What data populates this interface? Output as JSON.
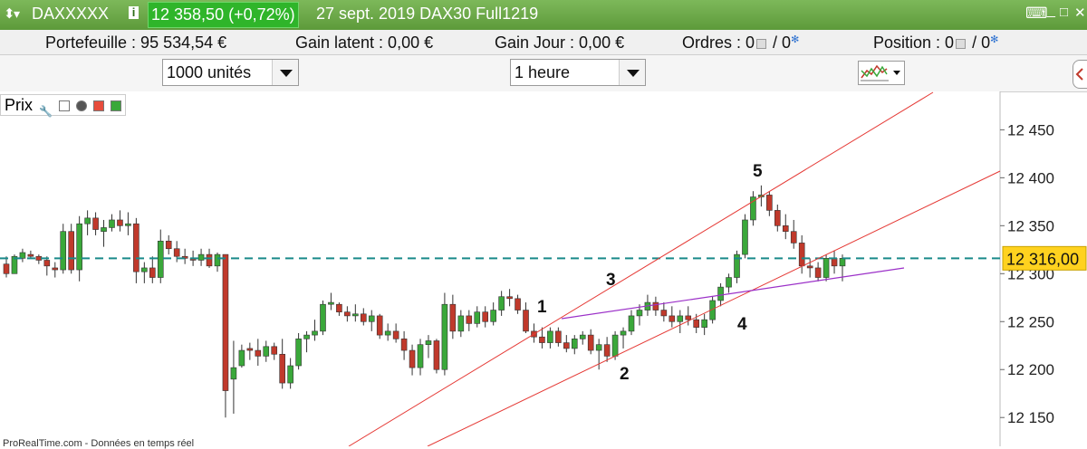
{
  "titlebar": {
    "symbol": "DAXXXXX",
    "quote": "12 358,50 (+0,72%)",
    "description": "27 sept. 2019 DAX30 Full1219"
  },
  "infobar": {
    "portefeuille": "Portefeuille : 95 534,54 €",
    "gain_latent": "Gain latent : 0,00 €",
    "gain_jour": "Gain Jour : 0,00 €",
    "ordres_label": "Ordres : 0",
    "ordres_sep": "/ 0",
    "position_label": "Position : 0",
    "position_sep": "/ 0"
  },
  "toolbar": {
    "quantity": "1000 unités",
    "timeframe": "1 heure"
  },
  "panel": {
    "title": "Prix"
  },
  "footer": "ProRealTime.com - Données en temps réel",
  "colors": {
    "up": "#3aa83a",
    "down": "#c0392b",
    "channel": "#e53935",
    "trend": "#9b30c8",
    "level": "#1a8a8a",
    "price_tag": "#ffd21f"
  },
  "chart_data": {
    "type": "candlestick",
    "ylim": [
      12120,
      12490
    ],
    "y_ticks": [
      "12 450",
      "12 400",
      "12 350",
      "12 300",
      "12 250",
      "12 200",
      "12 150"
    ],
    "current_price_label": "12 316,00",
    "current_price": 12316,
    "wave_labels": [
      "1",
      "2",
      "3",
      "4",
      "5"
    ],
    "candles": [
      [
        12310,
        12318,
        12296,
        12300
      ],
      [
        12300,
        12320,
        12312,
        12318
      ],
      [
        12316,
        12326,
        12312,
        12322
      ],
      [
        12320,
        12324,
        12316,
        12318
      ],
      [
        12318,
        12320,
        12310,
        12314
      ],
      [
        12314,
        12318,
        12298,
        12308
      ],
      [
        12306,
        12312,
        12296,
        12304
      ],
      [
        12304,
        12352,
        12300,
        12344
      ],
      [
        12344,
        12352,
        12300,
        12304
      ],
      [
        12304,
        12360,
        12292,
        12352
      ],
      [
        12352,
        12366,
        12340,
        12358
      ],
      [
        12358,
        12364,
        12340,
        12346
      ],
      [
        12344,
        12356,
        12328,
        12348
      ],
      [
        12348,
        12362,
        12344,
        12356
      ],
      [
        12356,
        12366,
        12344,
        12350
      ],
      [
        12350,
        12364,
        12340,
        12352
      ],
      [
        12352,
        12358,
        12290,
        12302
      ],
      [
        12302,
        12312,
        12290,
        12306
      ],
      [
        12306,
        12318,
        12290,
        12296
      ],
      [
        12296,
        12346,
        12290,
        12334
      ],
      [
        12334,
        12340,
        12320,
        12326
      ],
      [
        12326,
        12334,
        12312,
        12318
      ],
      [
        12318,
        12326,
        12310,
        12316
      ],
      [
        12316,
        12324,
        12308,
        12314
      ],
      [
        12314,
        12326,
        12308,
        12320
      ],
      [
        12320,
        12326,
        12306,
        12308
      ],
      [
        12308,
        12322,
        12302,
        12320
      ],
      [
        12320,
        12314,
        12150,
        12178
      ],
      [
        12190,
        12230,
        12154,
        12202
      ],
      [
        12204,
        12226,
        12202,
        12220
      ],
      [
        12222,
        12228,
        12210,
        12220
      ],
      [
        12220,
        12232,
        12204,
        12214
      ],
      [
        12214,
        12230,
        12208,
        12224
      ],
      [
        12224,
        12228,
        12210,
        12216
      ],
      [
        12216,
        12232,
        12180,
        12186
      ],
      [
        12186,
        12212,
        12180,
        12204
      ],
      [
        12204,
        12238,
        12200,
        12232
      ],
      [
        12232,
        12240,
        12218,
        12236
      ],
      [
        12236,
        12252,
        12230,
        12240
      ],
      [
        12240,
        12272,
        12236,
        12268
      ],
      [
        12268,
        12280,
        12262,
        12270
      ],
      [
        12268,
        12270,
        12256,
        12260
      ],
      [
        12260,
        12266,
        12250,
        12256
      ],
      [
        12256,
        12268,
        12250,
        12258
      ],
      [
        12258,
        12264,
        12246,
        12250
      ],
      [
        12250,
        12262,
        12240,
        12256
      ],
      [
        12256,
        12258,
        12232,
        12236
      ],
      [
        12236,
        12248,
        12230,
        12240
      ],
      [
        12240,
        12248,
        12228,
        12232
      ],
      [
        12232,
        12240,
        12210,
        12220
      ],
      [
        12220,
        12226,
        12194,
        12202
      ],
      [
        12202,
        12232,
        12194,
        12226
      ],
      [
        12226,
        12236,
        12212,
        12230
      ],
      [
        12230,
        12232,
        12196,
        12200
      ],
      [
        12200,
        12280,
        12194,
        12268
      ],
      [
        12268,
        12278,
        12232,
        12240
      ],
      [
        12240,
        12262,
        12234,
        12256
      ],
      [
        12256,
        12262,
        12240,
        12248
      ],
      [
        12248,
        12266,
        12244,
        12260
      ],
      [
        12260,
        12266,
        12244,
        12250
      ],
      [
        12250,
        12270,
        12246,
        12262
      ],
      [
        12262,
        12282,
        12256,
        12276
      ],
      [
        12276,
        12284,
        12266,
        12274
      ],
      [
        12274,
        12278,
        12258,
        12262
      ],
      [
        12262,
        12270,
        12238,
        12240
      ],
      [
        12240,
        12248,
        12228,
        12234
      ],
      [
        12234,
        12244,
        12222,
        12228
      ],
      [
        12228,
        12244,
        12222,
        12240
      ],
      [
        12240,
        12244,
        12224,
        12228
      ],
      [
        12228,
        12236,
        12218,
        12222
      ],
      [
        12222,
        12236,
        12216,
        12232
      ],
      [
        12232,
        12240,
        12226,
        12236
      ],
      [
        12236,
        12242,
        12216,
        12220
      ],
      [
        12220,
        12232,
        12200,
        12226
      ],
      [
        12226,
        12234,
        12208,
        12214
      ],
      [
        12214,
        12240,
        12210,
        12236
      ],
      [
        12236,
        12244,
        12222,
        12240
      ],
      [
        12240,
        12262,
        12236,
        12256
      ],
      [
        12256,
        12268,
        12246,
        12262
      ],
      [
        12262,
        12278,
        12256,
        12270
      ],
      [
        12270,
        12276,
        12256,
        12262
      ],
      [
        12262,
        12270,
        12250,
        12256
      ],
      [
        12256,
        12266,
        12244,
        12250
      ],
      [
        12250,
        12262,
        12238,
        12256
      ],
      [
        12256,
        12266,
        12246,
        12252
      ],
      [
        12252,
        12258,
        12238,
        12244
      ],
      [
        12244,
        12258,
        12236,
        12252
      ],
      [
        12252,
        12276,
        12248,
        12272
      ],
      [
        12272,
        12290,
        12266,
        12286
      ],
      [
        12286,
        12300,
        12280,
        12296
      ],
      [
        12296,
        12324,
        12290,
        12320
      ],
      [
        12320,
        12362,
        12316,
        12356
      ],
      [
        12356,
        12386,
        12350,
        12380
      ],
      [
        12380,
        12392,
        12370,
        12382
      ],
      [
        12382,
        12386,
        12360,
        12366
      ],
      [
        12366,
        12372,
        12344,
        12350
      ],
      [
        12350,
        12362,
        12336,
        12344
      ],
      [
        12344,
        12356,
        12326,
        12332
      ],
      [
        12332,
        12340,
        12300,
        12308
      ],
      [
        12308,
        12316,
        12296,
        12306
      ],
      [
        12306,
        12312,
        12292,
        12296
      ],
      [
        12296,
        12320,
        12292,
        12316
      ],
      [
        12316,
        12324,
        12300,
        12308
      ],
      [
        12308,
        12320,
        12292,
        12316
      ]
    ]
  }
}
